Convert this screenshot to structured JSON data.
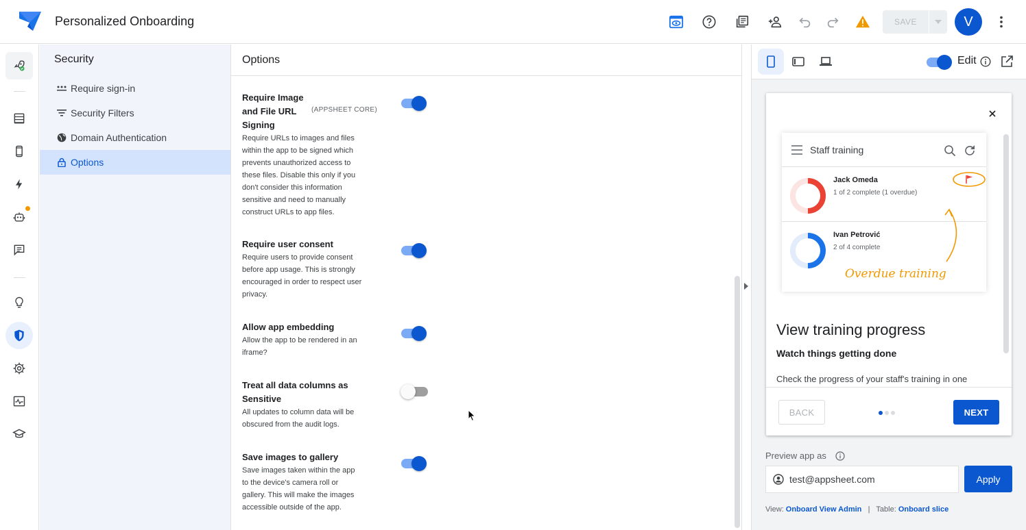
{
  "header": {
    "app_title": "Personalized Onboarding",
    "save_label": "SAVE",
    "avatar_initial": "V",
    "icons": [
      "preview-icon",
      "help-icon",
      "copy-icon",
      "add-person-icon",
      "undo-icon",
      "redo-icon",
      "warning-icon",
      "more-vert-icon"
    ]
  },
  "rail": {
    "items": [
      "home-rocket-icon",
      "data-icon",
      "app-icon",
      "automation-icon",
      "bot-icon",
      "chat-icon",
      "idea-icon",
      "security-icon",
      "settings-icon",
      "monitor-icon",
      "learn-icon"
    ],
    "active": "security-icon"
  },
  "subnav": {
    "title": "Security",
    "items": [
      {
        "label": "Require sign-in",
        "icon": "dots-icon"
      },
      {
        "label": "Security Filters",
        "icon": "filter-icon"
      },
      {
        "label": "Domain Authentication",
        "icon": "globe-icon"
      },
      {
        "label": "Options",
        "icon": "lock-icon",
        "selected": true
      }
    ]
  },
  "options": {
    "title": "Options",
    "items": [
      {
        "title_lines": [
          "Require Image",
          "and File URL",
          "Signing"
        ],
        "tag": "(APPSHEET CORE)",
        "desc_lines": [
          "Require URLs to images and files",
          "within the app to be signed which",
          "prevents unauthorized access to",
          "these files. Disable this only if you",
          "don't consider this information",
          "sensitive and need to manually",
          "construct URLs to app files."
        ],
        "enabled": true
      },
      {
        "title_lines": [
          "Require user consent"
        ],
        "desc_lines": [
          "Require users to provide consent",
          "before app usage. This is strongly",
          "encouraged in order to respect user",
          "privacy."
        ],
        "enabled": true
      },
      {
        "title_lines": [
          "Allow app embedding"
        ],
        "desc_lines": [
          "Allow the app to be rendered in an",
          "iframe?"
        ],
        "enabled": true
      },
      {
        "title_lines": [
          "Treat all data columns as",
          "Sensitive"
        ],
        "desc_lines": [
          "All updates to column data will be",
          "obscured from the audit logs."
        ],
        "enabled": false
      },
      {
        "title_lines": [
          "Save images to gallery"
        ],
        "desc_lines": [
          "Save images taken within the app",
          "to the device's camera roll or",
          "gallery. This will make the images",
          "accessible outside of the app."
        ],
        "enabled": true
      }
    ]
  },
  "preview": {
    "edit_label": "Edit",
    "edit_enabled": true,
    "onboarding": {
      "illustration": {
        "app_title": "Staff training",
        "rows": [
          {
            "name": "Jack Omeda",
            "status": "1 of 2 complete (1 overdue)",
            "progress": 0.5,
            "color": "#ea4335"
          },
          {
            "name": "Ivan Petrović",
            "status": "2 of 4 complete",
            "progress": 0.5,
            "color": "#1a73e8"
          }
        ],
        "annotation": "Overdue training"
      },
      "heading": "View training progress",
      "subheading": "Watch things getting done",
      "body": "Check the progress of your staff's training in one",
      "back_label": "BACK",
      "next_label": "NEXT",
      "page": 1,
      "pages": 3
    },
    "preview_as_label": "Preview app as",
    "preview_as_value": "test@appsheet.com",
    "apply_label": "Apply",
    "footer": {
      "view_label": "View:",
      "view_value": "Onboard View Admin",
      "separator": "|",
      "table_label": "Table:",
      "table_value": "Onboard slice"
    }
  },
  "colors": {
    "accent": "#0b57d0",
    "toggle_track": "#7baaf7",
    "warning": "#f29900",
    "subnav_bg": "#f1f5fb",
    "subnav_selected": "#d3e3fd"
  }
}
